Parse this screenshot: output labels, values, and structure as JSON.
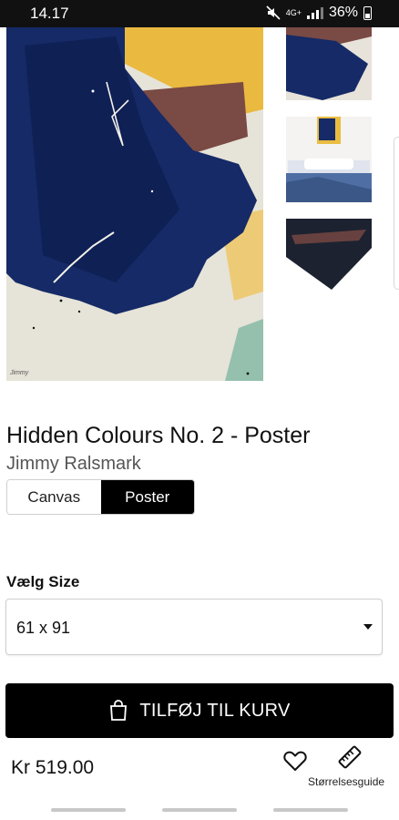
{
  "status_bar": {
    "time": "14.17",
    "network": "4G+",
    "battery": "36%"
  },
  "product": {
    "title": "Hidden Colours No. 2 - Poster",
    "artist": "Jimmy Ralsmark",
    "formats": [
      "Canvas",
      "Poster"
    ],
    "selected_format": "Poster",
    "signature": "Jimmy"
  },
  "size_section": {
    "label": "Vælg Size",
    "selected": "61 x 91"
  },
  "cart": {
    "add_label": "TILFØJ TIL KURV"
  },
  "footer": {
    "price": "Kr 519.00",
    "size_guide_label": "Størrelsesguide"
  },
  "icons": {
    "mute": "mute-icon",
    "signal": "signal-icon",
    "battery": "battery-icon",
    "bag": "shopping-bag-icon",
    "favorite": "heart-icon",
    "size_guide": "ruler-icon",
    "dropdown": "caret-down-icon"
  },
  "colors": {
    "primary": "#000000",
    "accent_navy": "#142058",
    "accent_yellow": "#e9bd40"
  }
}
